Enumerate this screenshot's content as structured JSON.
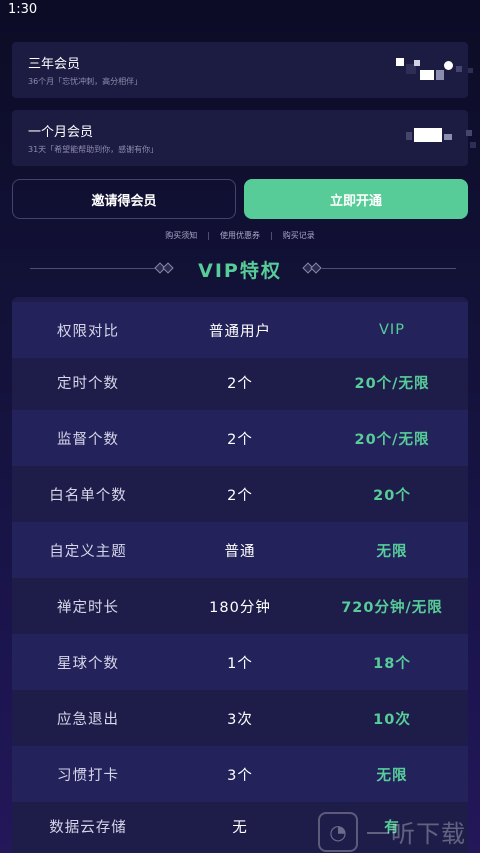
{
  "status_bar": {
    "time": "1:30"
  },
  "plans": [
    {
      "name": "三年会员",
      "desc": "36个月「忘忧冲刺，高分相伴」"
    },
    {
      "name": "一个月会员",
      "desc": "31天「希望能帮助到你，感谢有你」"
    }
  ],
  "actions": {
    "invite_label": "邀请得会员",
    "open_label": "立即开通"
  },
  "links": [
    "购买须知",
    "使用优惠券",
    "购买记录"
  ],
  "links_separator": "|",
  "section": {
    "title": "VIP特权"
  },
  "table": {
    "header": [
      "权限对比",
      "普通用户",
      "VIP"
    ],
    "rows": [
      [
        "定时个数",
        "2个",
        "20个/无限"
      ],
      [
        "监督个数",
        "2个",
        "20个/无限"
      ],
      [
        "白名单个数",
        "2个",
        "20个"
      ],
      [
        "自定义主题",
        "普通",
        "无限"
      ],
      [
        "禅定时长",
        "180分钟",
        "720分钟/无限"
      ],
      [
        "星球个数",
        "1个",
        "18个"
      ],
      [
        "应急退出",
        "3次",
        "10次"
      ],
      [
        "习惯打卡",
        "3个",
        "无限"
      ],
      [
        "数据云存储",
        "无",
        "有"
      ]
    ]
  },
  "watermark": {
    "icon": "ear-icon",
    "text": "一听下载"
  },
  "colors": {
    "accent": "#57cc99",
    "background": "#13123a",
    "card": "#1c1b42",
    "table": "#1e1d4a",
    "table_alt": "#23225a"
  }
}
